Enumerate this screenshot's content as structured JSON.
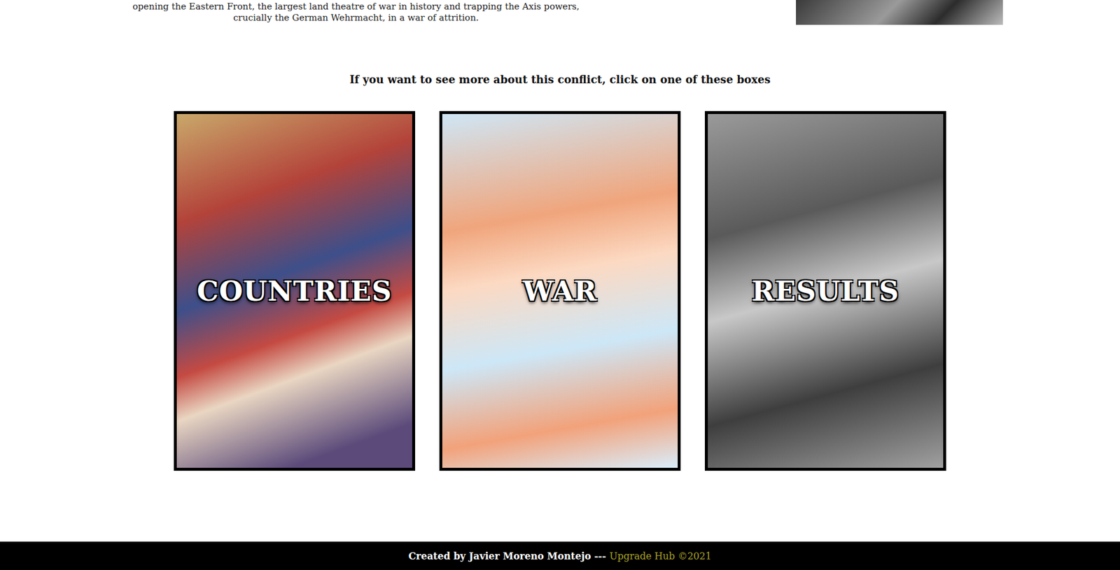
{
  "intro": {
    "lines": [
      "opening the Eastern Front, the largest land theatre of war in history and trapping the Axis powers,",
      "crucially the German Wehrmacht, in a war of attrition."
    ]
  },
  "heading": "If you want to see more about this conflict, click on one of these boxes",
  "cards": [
    {
      "label": "COUNTRIES"
    },
    {
      "label": "WAR"
    },
    {
      "label": "RESULTS"
    }
  ],
  "footer": {
    "credit": "Created by Javier Moreno Montejo ---",
    "link": "Upgrade Hub ©2021"
  }
}
